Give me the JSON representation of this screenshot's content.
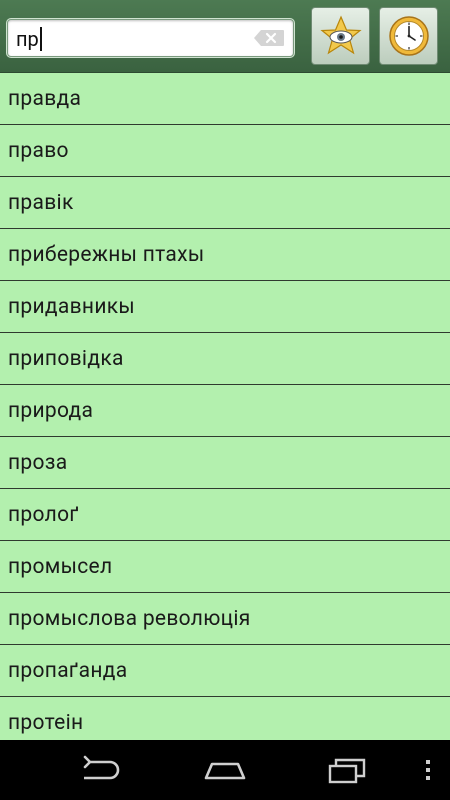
{
  "search": {
    "value": "пр",
    "placeholder": ""
  },
  "toolbar": {
    "favorites_icon": "star-eye-icon",
    "history_icon": "clock-icon"
  },
  "words": [
    "правда",
    "право",
    "правік",
    "прибережны птахы",
    "придавникы",
    "приповідка",
    "природа",
    "проза",
    "пролоґ",
    "промысел",
    "промыслова революція",
    "пропаґанда",
    "протеін"
  ],
  "colors": {
    "list_bg": "#b3f0ae",
    "topbar_bg": "#3f6a45",
    "navbar_bg": "#000000"
  },
  "navbar": {
    "back_icon": "back-icon",
    "home_icon": "home-icon",
    "recents_icon": "recents-icon",
    "menu_icon": "menu-icon"
  }
}
